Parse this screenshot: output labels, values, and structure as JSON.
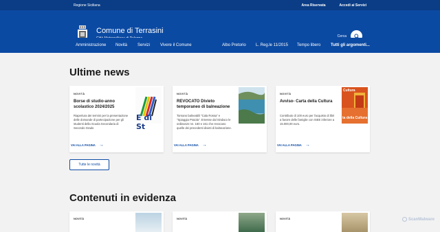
{
  "topbar": {
    "region": "Regione Siciliana",
    "reserved": "Area Riservata",
    "services_access": "Accedi ai Servizi"
  },
  "header": {
    "title": "Comune di Terrasini",
    "subtitle": "Città Metropolitana di Palermo",
    "search_label": "Cerca"
  },
  "nav": {
    "items": [
      "Amministrazione",
      "Novità",
      "Servizi",
      "Vivere il Comune"
    ],
    "secondary": [
      "Albo Pretorio",
      "L. Reg.le 11/2015",
      "Tempo libero",
      "Tutti gli argomenti..."
    ]
  },
  "news": {
    "heading": "Ultime news",
    "cards": [
      {
        "category": "NOVITÀ",
        "title": "Borse di studio-anno scolastico 2024/2025",
        "desc": "Riapertura dei termini per la presentazione delle domande di partecipazione per gli studenti della Scuola Secondaria di Secondo Grado",
        "more": "VAI ALLA PAGINA",
        "img_text": "E di St"
      },
      {
        "category": "NOVITÀ",
        "title": "REVOCATO Divieto temporaneo di balneazione",
        "desc": "Tornano balneabili \"Cala Rossa\" e \"Spiaggia Praiola\". Emesse dal Sindaco le ordinanze nn. 160 e 161 che revocano quelle dei precedenti divieti di balneazione.",
        "more": "VAI ALLA PAGINA"
      },
      {
        "category": "NOVITÀ",
        "title": "Avviso- Carta della Cultura",
        "desc": "Contributo di 100 euro per l'acquisto di libri a favore delle famiglie con ISEE inferiore a 15.000,00 euro.",
        "more": "VAI ALLA PAGINA",
        "img_text_top": "Cultura",
        "img_text_bottom": "ta della Cultura"
      }
    ],
    "all_button": "Tutte le novità"
  },
  "featured": {
    "heading": "Contenuti in evidenza",
    "cards": [
      {
        "category": "NOVITÀ"
      },
      {
        "category": "NOVITÀ"
      },
      {
        "category": "NOVITÀ"
      }
    ]
  },
  "watermark": "ScanMalware",
  "colors": {
    "header": "#0b4aa3",
    "topbar": "#0a3d86",
    "background": "#f2f2f2",
    "link": "#0b4aa3"
  }
}
